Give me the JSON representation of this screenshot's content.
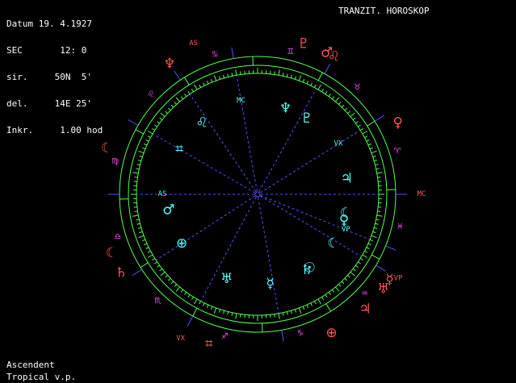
{
  "info": {
    "lines": [
      "Datum 19. 4.1927",
      "SEC       12: 0",
      "sir.     50N  5'",
      "del.     14E 25'",
      "Inkr.     1.00 hod"
    ]
  },
  "title": "TRANZIT. HOROSKOP",
  "footer": {
    "line1": "Ascendent",
    "line2": "Tropical v.p."
  },
  "colors": {
    "background": "#000000",
    "ring": "#55ff55",
    "axis": "#5555ff",
    "natal": "#55ffff",
    "transit": "#ff5555",
    "sign": "#ff55ff",
    "text": "#ffffff"
  },
  "wheel": {
    "signs": [
      {
        "name": "aries-icon",
        "glyph": "♈",
        "angle": -17
      },
      {
        "name": "taurus-icon",
        "glyph": "♉",
        "angle": -47
      },
      {
        "name": "gemini-icon",
        "glyph": "♊",
        "angle": -77
      },
      {
        "name": "cancer-icon",
        "glyph": "♋",
        "angle": -107
      },
      {
        "name": "leo-icon",
        "glyph": "♌",
        "angle": -137
      },
      {
        "name": "virgo-icon",
        "glyph": "♍",
        "angle": -167
      },
      {
        "name": "libra-icon",
        "glyph": "♎",
        "angle": 163
      },
      {
        "name": "scorpio-icon",
        "glyph": "♏",
        "angle": 133
      },
      {
        "name": "sagittarius-icon",
        "glyph": "♐",
        "angle": 103
      },
      {
        "name": "capricorn-icon",
        "glyph": "♑",
        "angle": 73
      },
      {
        "name": "aquarius-icon",
        "glyph": "♒",
        "angle": 43
      },
      {
        "name": "pisces-icon",
        "glyph": "♓",
        "angle": 13
      }
    ],
    "natal_points": [
      {
        "name": "mc-label",
        "text": "MC",
        "angle": -100,
        "type": "label"
      },
      {
        "name": "as-label",
        "text": "AS",
        "angle": 180,
        "type": "label"
      },
      {
        "name": "vx-label",
        "text": "VX",
        "angle": -32,
        "type": "label"
      },
      {
        "name": "vp-label",
        "text": "VP",
        "angle": 22,
        "type": "label"
      },
      {
        "name": "natal-neptune-icon",
        "glyph": "♆",
        "angle": -72
      },
      {
        "name": "natal-pluto-icon",
        "glyph": "♇",
        "angle": -57
      },
      {
        "name": "natal-leo-icon",
        "glyph": "♌",
        "angle": -128
      },
      {
        "name": "natal-jupiter-icon",
        "glyph": "♃",
        "angle": -10
      },
      {
        "name": "natal-moon-icon",
        "glyph": "☾",
        "angle": 12
      },
      {
        "name": "natal-venus-icon",
        "glyph": "♀",
        "angle": 17
      },
      {
        "name": "natal-moon2-icon",
        "glyph": "☾",
        "angle": 33
      },
      {
        "name": "natal-sun-icon",
        "glyph": "☉",
        "angle": 55
      },
      {
        "name": "natal-saturn-icon",
        "glyph": "♄",
        "angle": 57
      },
      {
        "name": "natal-mercury-icon",
        "glyph": "☿",
        "angle": 82
      },
      {
        "name": "natal-uranus-icon",
        "glyph": "♅",
        "angle": 110
      },
      {
        "name": "natal-earth-icon",
        "glyph": "⊕",
        "angle": 147
      },
      {
        "name": "natal-mars-icon",
        "glyph": "♂",
        "angle": 170
      },
      {
        "name": "natal-fortune-icon",
        "glyph": "⌗",
        "angle": -150
      }
    ],
    "transit_points": [
      {
        "name": "transit-as-label",
        "text": "AS",
        "angle": -113,
        "type": "label"
      },
      {
        "name": "transit-mc-label",
        "text": "MC",
        "angle": 0,
        "type": "label"
      },
      {
        "name": "transit-vp-label",
        "text": "VP",
        "angle": 31,
        "type": "label"
      },
      {
        "name": "transit-vx-label",
        "text": "VX",
        "angle": 118,
        "type": "label"
      },
      {
        "name": "transit-neptune-icon",
        "glyph": "♆",
        "angle": -124
      },
      {
        "name": "transit-pluto-icon",
        "glyph": "♇",
        "angle": -73
      },
      {
        "name": "transit-leo-icon",
        "glyph": "♌",
        "angle": -61
      },
      {
        "name": "transit-mars-icon",
        "glyph": "♂",
        "angle": -64
      },
      {
        "name": "transit-venus-icon",
        "glyph": "♀",
        "angle": -27
      },
      {
        "name": "transit-mercury-icon",
        "glyph": "☿",
        "angle": 33
      },
      {
        "name": "transit-uranus-icon",
        "glyph": "♅",
        "angle": 37
      },
      {
        "name": "transit-jupiter-icon",
        "glyph": "♃",
        "angle": 47
      },
      {
        "name": "transit-earth-icon",
        "glyph": "⊕",
        "angle": 62
      },
      {
        "name": "transit-fortune-icon",
        "glyph": "⌗",
        "angle": 108
      },
      {
        "name": "transit-saturn-icon",
        "glyph": "♄",
        "angle": 150
      },
      {
        "name": "transit-moon-icon",
        "glyph": "☾",
        "angle": 158
      },
      {
        "name": "transit-moon2-icon",
        "glyph": "☾",
        "angle": -163
      }
    ]
  }
}
